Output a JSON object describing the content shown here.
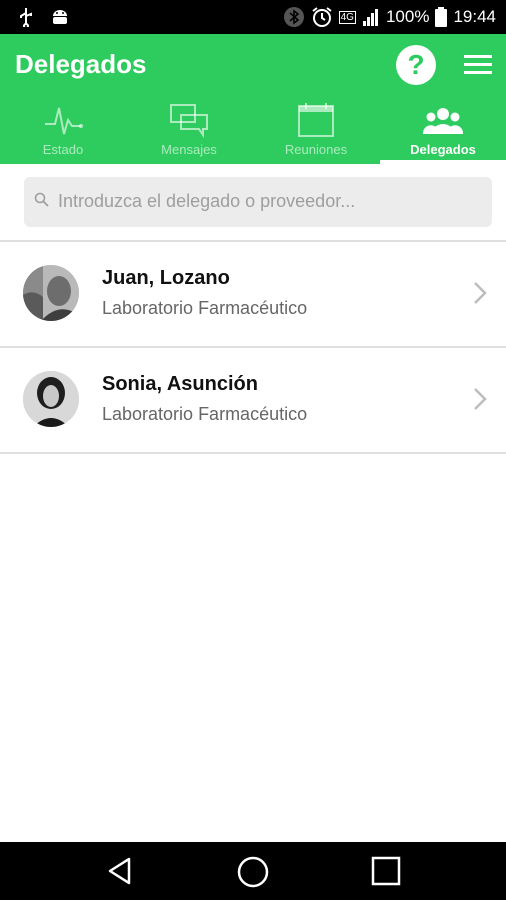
{
  "status_bar": {
    "battery": "100%",
    "time": "19:44",
    "network": "4G",
    "icons_left": [
      "usb-icon",
      "android-icon"
    ],
    "icons_right": [
      "bluetooth-icon",
      "alarm-icon",
      "signal-icon",
      "battery-icon"
    ]
  },
  "app_bar": {
    "title": "Delegados",
    "help_label": "?",
    "color": "#2ecc5e"
  },
  "tabs": [
    {
      "label": "Estado",
      "icon": "pulse-icon",
      "active": false
    },
    {
      "label": "Mensajes",
      "icon": "chat-icon",
      "active": false
    },
    {
      "label": "Reuniones",
      "icon": "calendar-icon",
      "active": false
    },
    {
      "label": "Delegados",
      "icon": "group-icon",
      "active": true
    }
  ],
  "search": {
    "placeholder": "Introduzca el delegado o proveedor..."
  },
  "delegates": [
    {
      "name": "Juan, Lozano",
      "company": "Laboratorio Farmacéutico"
    },
    {
      "name": "Sonia, Asunción",
      "company": "Laboratorio Farmacéutico"
    }
  ],
  "nav_bar": [
    "back-icon",
    "home-icon",
    "recents-icon"
  ]
}
